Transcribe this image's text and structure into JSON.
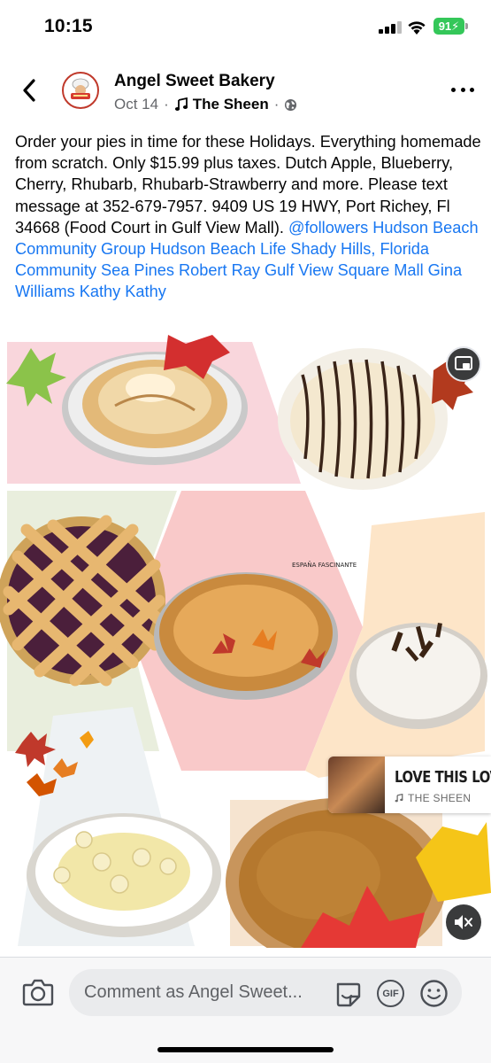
{
  "status_bar": {
    "time": "10:15",
    "battery": "91"
  },
  "header": {
    "page_name": "Angel Sweet Bakery",
    "date": "Oct 14",
    "separator": "·",
    "music_name": "The Sheen",
    "audience_icon": "globe-icon"
  },
  "post": {
    "text": "Order your pies in time for these Holidays.  Everything homemade from scratch.  Only $15.99 plus taxes.  Dutch Apple, Blueberry, Cherry, Rhubarb, Rhubarb-Strawberry and more.  Please text message at 352-679-7957.  9409 US 19 HWY, Port Richey, Fl 34668 (Food Court in Gulf View Mall). ",
    "tags": "@followers Hudson Beach Community Group Hudson Beach Life Shady Hills, Florida Community Sea Pines Robert Ray Gulf View Square Mall Gina Williams Kathy Kathy",
    "link_color": "#1877f2"
  },
  "media": {
    "collage_watermark": "ESPAÑA FASCINANTE",
    "music_card": {
      "title": "LOVE THIS LOV",
      "artist": "THE SHEEN"
    }
  },
  "comment_bar": {
    "placeholder": "Comment as Angel Sweet...",
    "gif_label": "GIF"
  }
}
